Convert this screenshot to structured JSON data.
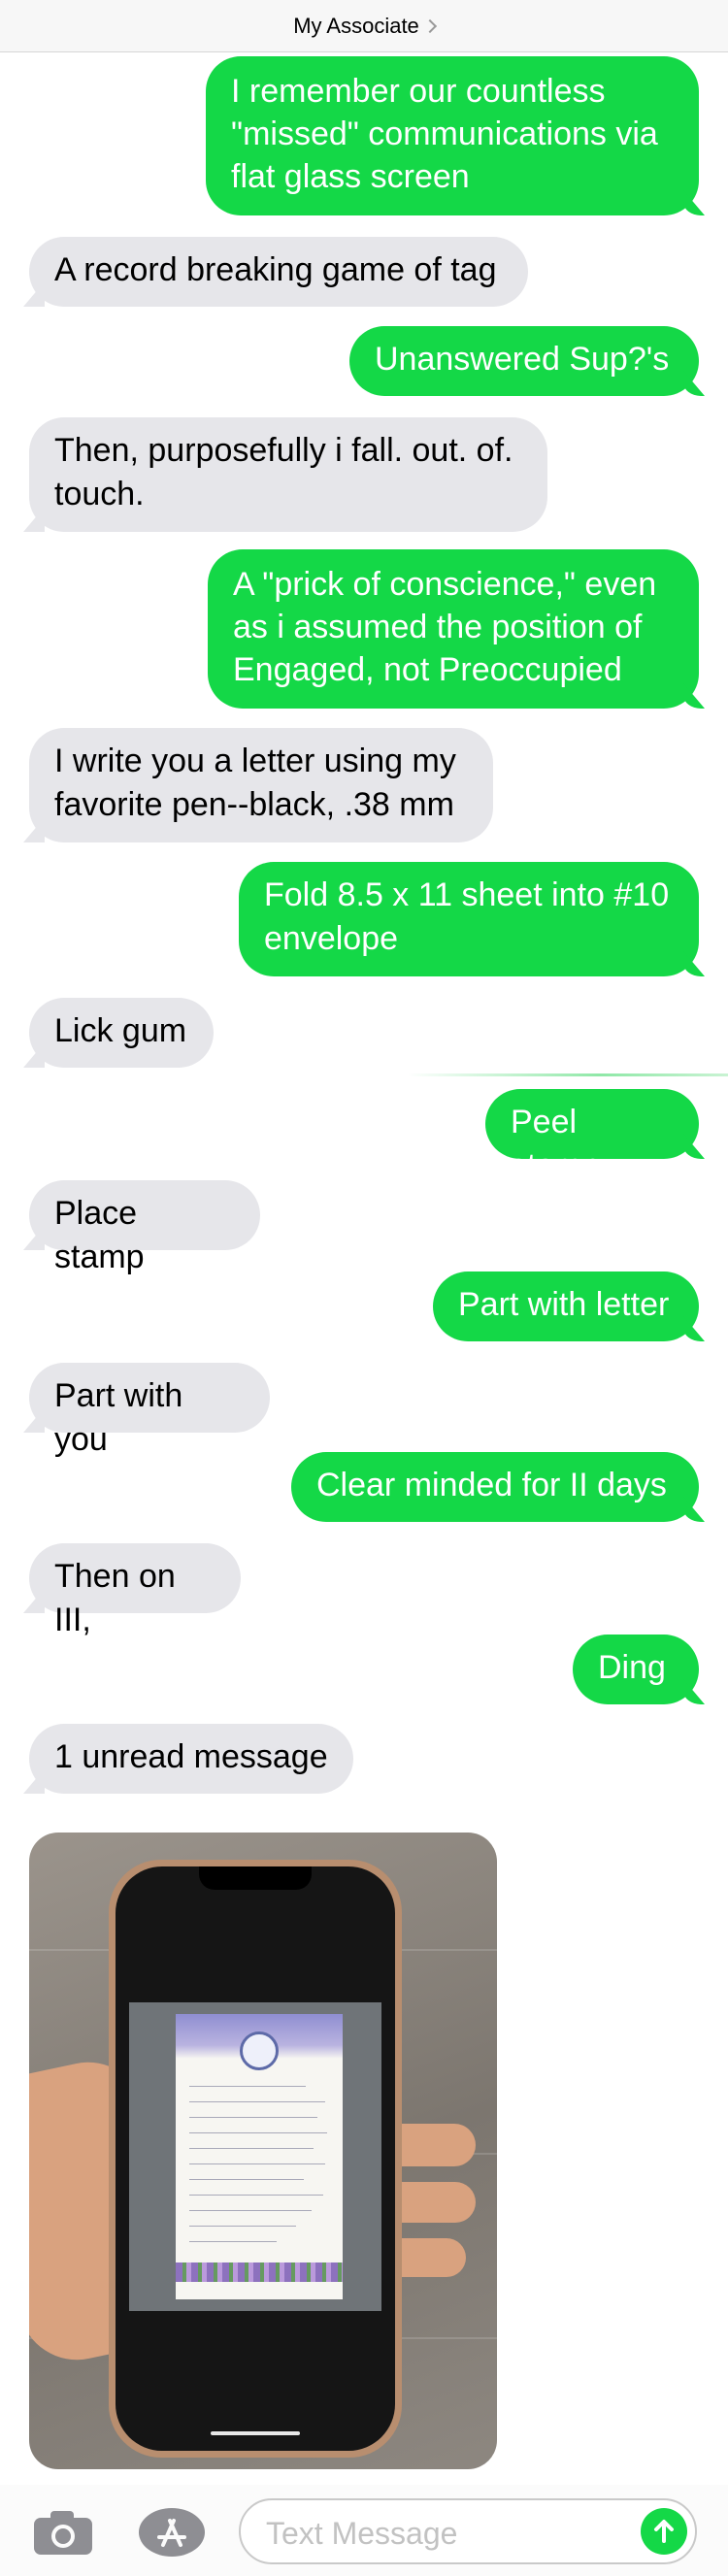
{
  "header": {
    "title": "My Associate"
  },
  "messages": [
    {
      "dir": "out",
      "text": "I remember our countless \"missed\" communications via flat glass screen"
    },
    {
      "dir": "in",
      "text": "A record breaking game of tag"
    },
    {
      "dir": "out",
      "text": "Unanswered Sup?'s"
    },
    {
      "dir": "in",
      "text": "Then, purposefully i fall. out. of. touch."
    },
    {
      "dir": "out",
      "text": "A \"prick of conscience,\" even as i assumed the position of Engaged, not Preoccupied"
    },
    {
      "dir": "in",
      "text": "I write you a letter using my favorite pen--black, .38 mm"
    },
    {
      "dir": "out",
      "text": "Fold 8.5 x 11 sheet into #10 envelope"
    },
    {
      "dir": "in",
      "text": "Lick gum"
    },
    {
      "dir": "out",
      "text": "Peel stamp"
    },
    {
      "dir": "in",
      "text": "Place stamp"
    },
    {
      "dir": "out",
      "text": "Part with letter"
    },
    {
      "dir": "in",
      "text": "Part with you"
    },
    {
      "dir": "out",
      "text": "Clear minded for II days"
    },
    {
      "dir": "in",
      "text": "Then on III,"
    },
    {
      "dir": "out",
      "text": "Ding"
    },
    {
      "dir": "in",
      "text": "1 unread message"
    }
  ],
  "attachment": {
    "type": "photo"
  },
  "compose": {
    "placeholder": "Text Message",
    "camera_icon": "camera-icon",
    "apps_icon": "app-store-icon",
    "send_icon": "arrow-up-icon"
  },
  "colors": {
    "outgoing": "#14d847",
    "incoming": "#e6e6ea",
    "header_bg": "#f7f7f7"
  }
}
